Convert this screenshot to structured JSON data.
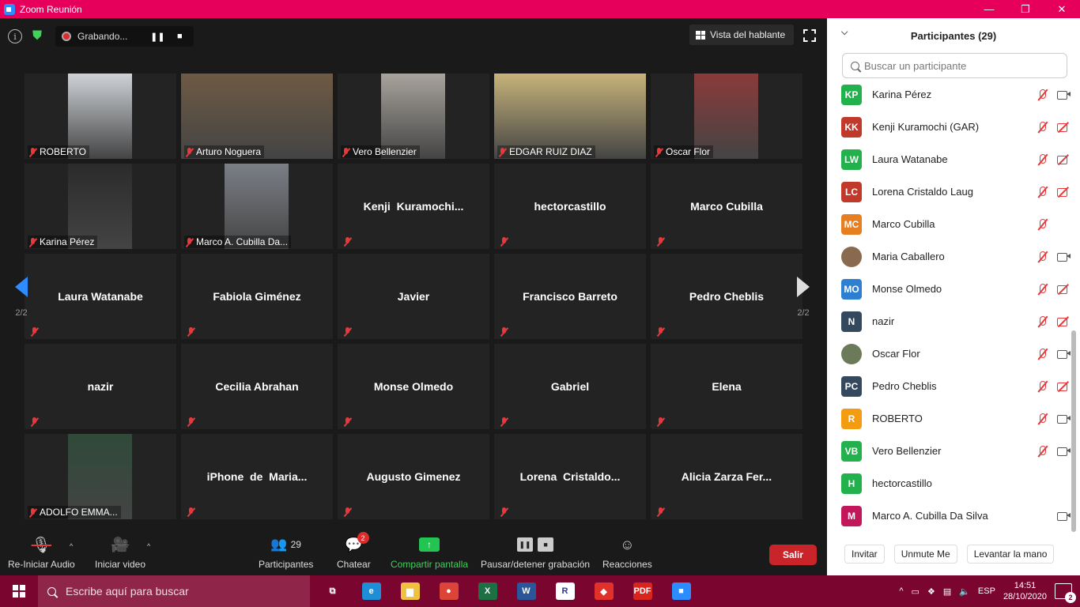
{
  "window": {
    "title": "Zoom Reunión"
  },
  "topbar": {
    "recording_label": "Grabando...",
    "view_label": "Vista del hablante"
  },
  "pagination": {
    "left": "2/2",
    "right": "2/2"
  },
  "tiles": [
    {
      "name": "ROBERTO",
      "video": true,
      "photo_color": "#cfd3d8"
    },
    {
      "name": "Arturo Noguera",
      "video": true,
      "photo_color": "#6e5a44"
    },
    {
      "name": "Vero Bellenzier",
      "video": true,
      "photo_color": "#a8a39c"
    },
    {
      "name": "EDGAR RUIZ DIAZ",
      "video": true,
      "photo_color": "#c7b37a"
    },
    {
      "name": "Oscar Flor",
      "video": true,
      "photo_color": "#8b3a3a"
    },
    {
      "name": "Karina Pérez",
      "video": true,
      "photo_color": "#2b2b2b"
    },
    {
      "name": "Marco A. Cubilla Da...",
      "video": true,
      "photo_color": "#7b7f86"
    },
    {
      "name": "Kenji  Kuramochi...",
      "video": false
    },
    {
      "name": "hectorcastillo",
      "video": false
    },
    {
      "name": "Marco Cubilla",
      "video": false
    },
    {
      "name": "Laura Watanabe",
      "video": false
    },
    {
      "name": "Fabiola Giménez",
      "video": false
    },
    {
      "name": "Javier",
      "video": false
    },
    {
      "name": "Francisco Barreto",
      "video": false
    },
    {
      "name": "Pedro Cheblis",
      "video": false
    },
    {
      "name": "nazir",
      "video": false
    },
    {
      "name": "Cecilia Abrahan",
      "video": false
    },
    {
      "name": "Monse Olmedo",
      "video": false
    },
    {
      "name": "Gabriel",
      "video": false
    },
    {
      "name": "Elena",
      "video": false
    },
    {
      "name": "ADOLFO EMMA...",
      "video": true,
      "photo_color": "#2f4a3a"
    },
    {
      "name": "iPhone  de  Maria...",
      "video": false
    },
    {
      "name": "Augusto Gimenez",
      "video": false
    },
    {
      "name": "Lorena  Cristaldo...",
      "video": false
    },
    {
      "name": "Alicia Zarza Fer...",
      "video": false
    }
  ],
  "toolbar": {
    "audio_label": "Re-Iniciar Audio",
    "video_label": "Iniciar video",
    "participants_label": "Participantes",
    "participants_count": "29",
    "chat_label": "Chatear",
    "chat_badge": "2",
    "share_label": "Compartir pantalla",
    "record_label": "Pausar/detener grabación",
    "reactions_label": "Reacciones",
    "leave_label": "Salir"
  },
  "panel": {
    "title": "Participantes (29)",
    "search_placeholder": "Buscar un participante",
    "participants": [
      {
        "initials": "KP",
        "name": "Karina Pérez",
        "color": "#23b14d",
        "mic": "off",
        "cam": "on"
      },
      {
        "initials": "KK",
        "name": "Kenji Kuramochi (GAR)",
        "color": "#c0392b",
        "mic": "off",
        "cam": "off"
      },
      {
        "initials": "LW",
        "name": "Laura Watanabe",
        "color": "#23b14d",
        "mic": "off",
        "cam": "off"
      },
      {
        "initials": "LC",
        "name": "Lorena Cristaldo Laug",
        "color": "#c0392b",
        "mic": "off",
        "cam": "off"
      },
      {
        "initials": "MC",
        "name": "Marco Cubilla",
        "color": "#e67e22",
        "mic": "off",
        "cam": "none"
      },
      {
        "initials": "",
        "name": "Maria Caballero",
        "color": "#8a6a4f",
        "mic": "off",
        "cam": "on"
      },
      {
        "initials": "MO",
        "name": "Monse Olmedo",
        "color": "#2d7fd1",
        "mic": "off",
        "cam": "off"
      },
      {
        "initials": "N",
        "name": "nazir",
        "color": "#34495e",
        "mic": "off",
        "cam": "off"
      },
      {
        "initials": "",
        "name": "Oscar Flor",
        "color": "#6b7b5a",
        "mic": "off",
        "cam": "on"
      },
      {
        "initials": "PC",
        "name": "Pedro Cheblis",
        "color": "#34495e",
        "mic": "off",
        "cam": "off"
      },
      {
        "initials": "R",
        "name": "ROBERTO",
        "color": "#f39c12",
        "mic": "off",
        "cam": "on"
      },
      {
        "initials": "VB",
        "name": "Vero Bellenzier",
        "color": "#23b14d",
        "mic": "off",
        "cam": "on"
      },
      {
        "initials": "H",
        "name": "hectorcastillo",
        "color": "#23b14d",
        "mic": "none",
        "cam": "none"
      },
      {
        "initials": "M",
        "name": "Marco A. Cubilla Da Silva",
        "color": "#c2185b",
        "mic": "none",
        "cam": "on"
      }
    ],
    "buttons": {
      "invite": "Invitar",
      "unmute": "Unmute Me",
      "raise": "Levantar la mano"
    }
  },
  "taskbar": {
    "search_placeholder": "Escribe aquí para buscar",
    "apps": [
      {
        "name": "task-view-icon",
        "text": "⧉",
        "bg": "transparent"
      },
      {
        "name": "edge-icon",
        "text": "e",
        "bg": "#1e8fd6"
      },
      {
        "name": "file-explorer-icon",
        "text": "▆",
        "bg": "#f0c040"
      },
      {
        "name": "chrome-icon",
        "text": "●",
        "bg": "#db4437"
      },
      {
        "name": "excel-icon",
        "text": "X",
        "bg": "#1d7044"
      },
      {
        "name": "word-icon",
        "text": "W",
        "bg": "#2b579a"
      },
      {
        "name": "r-app-icon",
        "text": "R",
        "bg": "#ffffff"
      },
      {
        "name": "anydesk-icon",
        "text": "◆",
        "bg": "#e0312b"
      },
      {
        "name": "pdf-icon",
        "text": "PDF",
        "bg": "#d8261e"
      },
      {
        "name": "zoom-taskbar-icon",
        "text": "■",
        "bg": "#2d8cff"
      }
    ],
    "lang": "ESP",
    "time": "14:51",
    "date": "28/10/2020",
    "notifications": "2"
  }
}
